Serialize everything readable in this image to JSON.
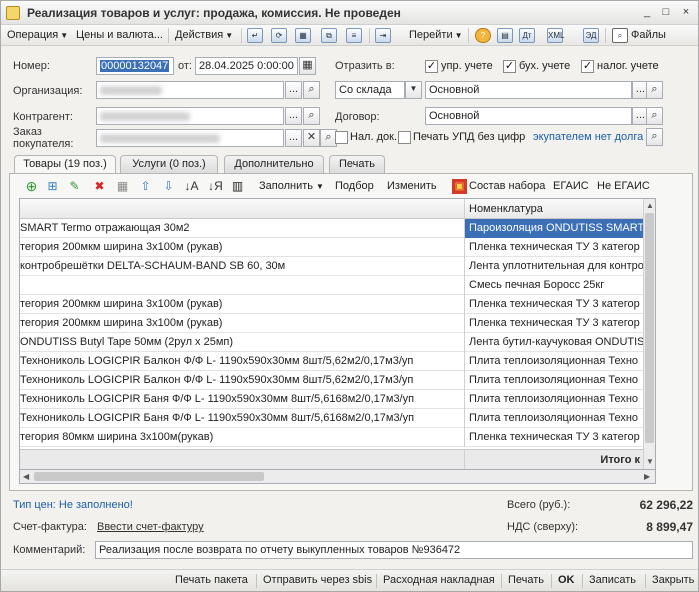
{
  "window": {
    "title": "Реализация товаров и услуг: продажа, комиссия. Не проведен",
    "controls": [
      "_",
      "□",
      "×"
    ]
  },
  "toolbar": {
    "operation": "Операция",
    "prices": "Цены и валюта...",
    "actions": "Действия",
    "goto": "Перейти",
    "files": "Файлы"
  },
  "header": {
    "number_label": "Номер:",
    "number_value": "00000132047",
    "date_label": "от:",
    "date_value": "28.04.2025  0:00:00",
    "org_label": "Организация:",
    "contractor_label": "Контрагент:",
    "order_label": "Заказ покупателя:",
    "reflect_label": "Отразить в:",
    "chk_upr": "упр. учете",
    "chk_buh": "бух. учете",
    "chk_nalog": "налог. учете",
    "warehouse_mode": "Со склада",
    "warehouse": "Основной",
    "contract_label": "Договор:",
    "contract": "Основной",
    "chk_nal_doc": "Нал. док.",
    "chk_print_upd": "Печать УПД без цифр",
    "debt_note": "экупателем нет долга"
  },
  "tabs": [
    {
      "label": "Товары (19 поз.)"
    },
    {
      "label": "Услуги (0 поз.)"
    },
    {
      "label": "Дополнительно"
    },
    {
      "label": "Печать"
    }
  ],
  "goods_toolbar": {
    "fill": "Заполнить",
    "pick": "Подбор",
    "change": "Изменить",
    "set_composition": "Состав набора",
    "egais": "ЕГАИС",
    "not_egais": "Не ЕГАИС"
  },
  "table": {
    "col2_header": "Номенклатура",
    "rows": [
      {
        "c1": "SMART Termo отражающая 30м2",
        "c2": "Пароизоляция ONDUTISS SMART"
      },
      {
        "c1": "тегория 200мкм ширина 3х100м (рукав)",
        "c2": "Пленка техническая ТУ 3 категор"
      },
      {
        "c1": "контробрешётки DELTA-SCHAUM-BAND SB 60, 30м",
        "c2": "Лента уплотнительная для контро"
      },
      {
        "c1": "",
        "c2": "Смесь печная Боросс 25кг"
      },
      {
        "c1": "тегория 200мкм ширина 3х100м (рукав)",
        "c2": "Пленка техническая ТУ 3 категор"
      },
      {
        "c1": "тегория 200мкм ширина 3х100м (рукав)",
        "c2": "Пленка техническая ТУ 3 категор"
      },
      {
        "c1": "ONDUTISS Butyl Tape 50мм (2рул х 25мп)",
        "c2": "Лента бутил-каучуковая ONDUTIS"
      },
      {
        "c1": "Технониколь LOGICPIR Балкон Ф/Ф L- 1190х590х30мм 8шт/5,62м2/0,17м3/уп",
        "c2": "Плита теплоизоляционная Техно"
      },
      {
        "c1": "Технониколь LOGICPIR Балкон Ф/Ф L- 1190х590х30мм 8шт/5,62м2/0,17м3/уп",
        "c2": "Плита теплоизоляционная Техно"
      },
      {
        "c1": "Технониколь LOGICPIR Баня Ф/Ф L- 1190х590х30мм 8шт/5,6168м2/0,17м3/уп",
        "c2": "Плита теплоизоляционная Техно"
      },
      {
        "c1": "Технониколь LOGICPIR Баня Ф/Ф L- 1190х590х30мм 8шт/5,6168м2/0,17м3/уп",
        "c2": "Плита теплоизоляционная Техно"
      },
      {
        "c1": "тегория 80мкм ширина 3х100м(рукав)",
        "c2": "Пленка техническая ТУ 3 категор"
      }
    ],
    "footer_total": "Итого к"
  },
  "summary": {
    "price_type": "Тип цен: Не заполнено!",
    "total_label": "Всего (руб.):",
    "total_value": "62 296,22",
    "invoice_label": "Счет-фактура:",
    "invoice_link": "Ввести счет-фактуру",
    "vat_label": "НДС (сверху):",
    "vat_value": "8 899,47",
    "comment_label": "Комментарий:",
    "comment_value": "Реализация после возврата по отчету выкупленных товаров №936472"
  },
  "bottom": {
    "print_package": "Печать пакета",
    "send_sbis": "Отправить через sbis",
    "waybill": "Расходная накладная",
    "print": "Печать",
    "ok": "OK",
    "save": "Записать",
    "close": "Закрыть"
  },
  "colors": {
    "selection": "#3b6fb6",
    "link": "#1c5fa8"
  }
}
